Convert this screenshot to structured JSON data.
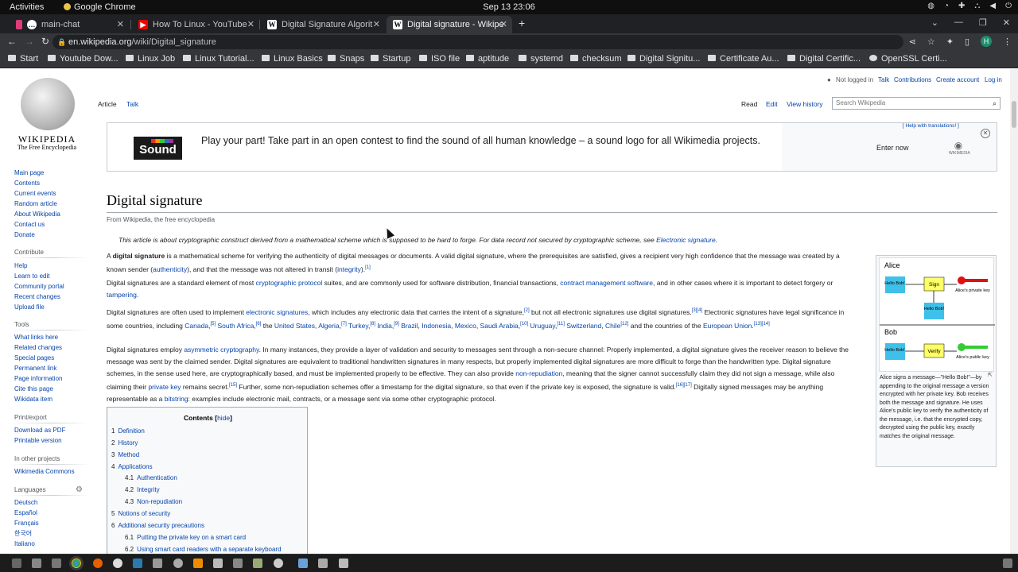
{
  "system": {
    "activities": "Activities",
    "app": "Google Chrome",
    "clock": "Sep 13  23:06"
  },
  "tabs": [
    {
      "label": "main-chat",
      "icon": "chat"
    },
    {
      "label": "How To Linux - YouTube",
      "icon": "youtube"
    },
    {
      "label": "Digital Signature Algorit",
      "icon": "W"
    },
    {
      "label": "Digital signature - Wikipe",
      "icon": "W"
    }
  ],
  "omnibox": {
    "host": "en.wikipedia.org",
    "path": "/wiki/Digital_signature"
  },
  "profile_initial": "H",
  "bookmarks": [
    "Start",
    "Youtube Dow...",
    "Linux Job",
    "Linux Tutorial...",
    "Linux Basics",
    "Snaps",
    "Startup",
    "ISO file",
    "aptitude",
    "systemd",
    "checksum",
    "Digital Signitu...",
    "Certificate Au...",
    "Digital Certific...",
    "OpenSSL Certi..."
  ],
  "wiki": {
    "logo_title": "WIKIPEDIA",
    "logo_sub": "The Free Encyclopedia",
    "nav": [
      "Main page",
      "Contents",
      "Current events",
      "Random article",
      "About Wikipedia",
      "Contact us",
      "Donate"
    ],
    "contribute_head": "Contribute",
    "contribute": [
      "Help",
      "Learn to edit",
      "Community portal",
      "Recent changes",
      "Upload file"
    ],
    "tools_head": "Tools",
    "tools": [
      "What links here",
      "Related changes",
      "Special pages",
      "Permanent link",
      "Page information",
      "Cite this page",
      "Wikidata item"
    ],
    "print_head": "Print/export",
    "print": [
      "Download as PDF",
      "Printable version"
    ],
    "other_head": "In other projects",
    "other": [
      "Wikimedia Commons"
    ],
    "lang_head": "Languages",
    "langs": [
      "Deutsch",
      "Español",
      "Français",
      "한국어",
      "Italiano"
    ],
    "tab_article": "Article",
    "tab_talk": "Talk",
    "tab_read": "Read",
    "tab_edit": "Edit",
    "tab_history": "View history",
    "personal": {
      "notlogged": "Not logged in",
      "talk": "Talk",
      "contrib": "Contributions",
      "create": "Create account",
      "login": "Log in"
    },
    "search_placeholder": "Search Wikipedia",
    "banner": {
      "logo": "Sound",
      "message": "Play your part! Take part in an open contest to find the sound of all human knowledge – a sound logo for all Wikimedia projects.",
      "enter": "Enter now",
      "help": "[ Help with translations! ]",
      "wm": "WIKIMEDIA"
    },
    "title": "Digital signature",
    "from": "From Wikipedia, the free encyclopedia",
    "hatnote_a": "This article is about cryptographic construct derived from a mathematical scheme which is supposed to be hard to forge. For data record not secured by cryptographic scheme, see ",
    "hatnote_link": "Electronic signature",
    "p1": {
      "a": "A ",
      "b": "digital signature",
      "c": " is a mathematical scheme for verifying the authenticity of digital messages or documents. A valid digital signature, where the prerequisites are satisfied, gives a recipient very high confidence that the message was created by a known sender (",
      "l1": "authenticity",
      "d": "), and that the message was not altered in transit (",
      "l2": "integrity",
      "e": ").",
      "s1": "[1]"
    },
    "p2": {
      "a": "Digital signatures are a standard element of most ",
      "l1": "cryptographic protocol",
      "b": " suites, and are commonly used for software distribution, financial transactions, ",
      "l2": "contract management software",
      "c": ", and in other cases where it is important to detect forgery or ",
      "l3": "tampering",
      "d": "."
    },
    "p3": {
      "a": "Digital signatures are often used to implement ",
      "l1": "electronic signatures",
      "b": ", which includes any electronic data that carries the intent of a signature,",
      "s1": "[2]",
      "c": " but not all electronic signatures use digital signatures.",
      "s2": "[3][4]",
      "d": " Electronic signatures have legal significance in some countries, including ",
      "l2": "Canada",
      "s3": "[5]",
      "l3": "South Africa",
      "s4": "[6]",
      "e": " the ",
      "l4": "United States",
      "l5": "Algeria",
      "s5": "[7]",
      "l6": "Turkey",
      "s6": "[8]",
      "l7": "India",
      "s7": "[9]",
      "l8": "Brazil",
      "l9": "Indonesia",
      "l10": "Mexico",
      "l11": "Saudi Arabia",
      "s8": "[10]",
      "l12": "Uruguay",
      "s9": "[11]",
      "l13": "Switzerland",
      "l14": "Chile",
      "s10": "[12]",
      "f": " and the countries of the ",
      "l15": "European Union",
      "s11": "[13][14]"
    },
    "p4": {
      "a": "Digital signatures employ ",
      "l1": "asymmetric cryptography",
      "b": ". In many instances, they provide a layer of validation and security to messages sent through a non-secure channel: Properly implemented, a digital signature gives the receiver reason to believe the message was sent by the claimed sender. Digital signatures are equivalent to traditional handwritten signatures in many respects, but properly implemented digital signatures are more difficult to forge than the handwritten type. Digital signature schemes, in the sense used here, are cryptographically based, and must be implemented properly to be effective. They can also provide ",
      "l2": "non-repudiation",
      "c": ", meaning that the signer cannot successfully claim they did not sign a message, while also claiming their ",
      "l3": "private key",
      "d": " remains secret.",
      "s1": "[15]",
      "e": " Further, some non-repudiation schemes offer a timestamp for the digital signature, so that even if the private key is exposed, the signature is valid.",
      "s2": "[16][17]",
      "f": " Digitally signed messages may be anything representable as a ",
      "l4": "bitstring",
      "g": ": examples include electronic mail, contracts, or a message sent via some other cryptographic protocol."
    },
    "figure": {
      "alice": "Alice",
      "bob": "Bob",
      "hello": "Hello Bob!",
      "sign": "Sign",
      "verify": "Verify",
      "alice_key": "Alice's private key",
      "alice_pub": "Alice's public key",
      "caption": "Alice signs a message—\"Hello Bob!\"—by appending to the original message a version encrypted with her private key. Bob receives both the message and signature. He uses Alice's public key to verify the authenticity of the message, i.e. that the encrypted copy, decrypted using the public key, exactly matches the original message."
    },
    "toc": {
      "title": "Contents",
      "hide": "hide",
      "items": [
        {
          "n": "1",
          "t": "Definition"
        },
        {
          "n": "2",
          "t": "History"
        },
        {
          "n": "3",
          "t": "Method"
        },
        {
          "n": "4",
          "t": "Applications"
        },
        {
          "n": "4.1",
          "t": "Authentication"
        },
        {
          "n": "4.2",
          "t": "Integrity"
        },
        {
          "n": "4.3",
          "t": "Non-repudiation"
        },
        {
          "n": "5",
          "t": "Notions of security"
        },
        {
          "n": "6",
          "t": "Additional security precautions"
        },
        {
          "n": "6.1",
          "t": "Putting the private key on a smart card"
        },
        {
          "n": "6.2",
          "t": "Using smart card readers with a separate keyboard"
        }
      ]
    }
  }
}
